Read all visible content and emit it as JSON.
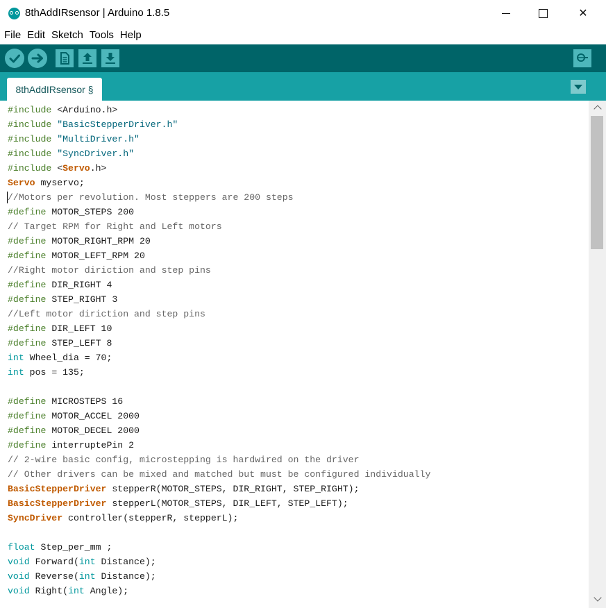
{
  "window": {
    "title": "8thAddIRsensor | Arduino 1.8.5",
    "controls": {
      "minimize": "minimize",
      "maximize": "maximize",
      "close": "✕"
    }
  },
  "menu": [
    "File",
    "Edit",
    "Sketch",
    "Tools",
    "Help"
  ],
  "toolbar": {
    "buttons": [
      {
        "name": "verify",
        "icon": "check-icon"
      },
      {
        "name": "upload",
        "icon": "arrow-right-icon"
      },
      {
        "name": "new",
        "icon": "document-icon"
      },
      {
        "name": "open",
        "icon": "arrow-up-icon"
      },
      {
        "name": "save",
        "icon": "arrow-down-icon"
      },
      {
        "name": "serial-monitor",
        "icon": "magnifier-icon"
      }
    ]
  },
  "tabs": [
    {
      "label": "8thAddIRsensor §",
      "active": true
    }
  ],
  "colors": {
    "toolbar": "#006468",
    "tabbar": "#17a1a5",
    "button": "#4db7bb",
    "keyword_class": "#c05a00",
    "keyword_type": "#00979c",
    "preprocessor": "#4a7f2a",
    "comment": "#666666",
    "string": "#00657a"
  },
  "editor": {
    "lines": [
      [
        [
          "preproc",
          "#include"
        ],
        [
          "plain",
          " <Arduino.h>"
        ]
      ],
      [
        [
          "preproc",
          "#include"
        ],
        [
          "plain",
          " "
        ],
        [
          "string",
          "\"BasicStepperDriver.h\""
        ]
      ],
      [
        [
          "preproc",
          "#include"
        ],
        [
          "plain",
          " "
        ],
        [
          "string",
          "\"MultiDriver.h\""
        ]
      ],
      [
        [
          "preproc",
          "#include"
        ],
        [
          "plain",
          " "
        ],
        [
          "string",
          "\"SyncDriver.h\""
        ]
      ],
      [
        [
          "preproc",
          "#include"
        ],
        [
          "plain",
          " <"
        ],
        [
          "class",
          "Servo"
        ],
        [
          "plain",
          ".h>"
        ]
      ],
      [
        [
          "class",
          "Servo"
        ],
        [
          "plain",
          " myservo;"
        ]
      ],
      [
        [
          "comment",
          "//Motors per revolution. Most steppers are 200 steps"
        ]
      ],
      [
        [
          "preproc",
          "#define"
        ],
        [
          "plain",
          " MOTOR_STEPS 200"
        ]
      ],
      [
        [
          "comment",
          "// Target RPM for Right and Left motors"
        ]
      ],
      [
        [
          "preproc",
          "#define"
        ],
        [
          "plain",
          " MOTOR_RIGHT_RPM 20"
        ]
      ],
      [
        [
          "preproc",
          "#define"
        ],
        [
          "plain",
          " MOTOR_LEFT_RPM 20"
        ]
      ],
      [
        [
          "comment",
          "//Right motor diriction and step pins"
        ]
      ],
      [
        [
          "preproc",
          "#define"
        ],
        [
          "plain",
          " DIR_RIGHT 4"
        ]
      ],
      [
        [
          "preproc",
          "#define"
        ],
        [
          "plain",
          " STEP_RIGHT 3"
        ]
      ],
      [
        [
          "comment",
          "//Left motor diriction and step pins"
        ]
      ],
      [
        [
          "preproc",
          "#define"
        ],
        [
          "plain",
          " DIR_LEFT 10"
        ]
      ],
      [
        [
          "preproc",
          "#define"
        ],
        [
          "plain",
          " STEP_LEFT 8"
        ]
      ],
      [
        [
          "type",
          "int"
        ],
        [
          "plain",
          " Wheel_dia = 70;"
        ]
      ],
      [
        [
          "type",
          "int"
        ],
        [
          "plain",
          " pos = 135;"
        ]
      ],
      [],
      [
        [
          "preproc",
          "#define"
        ],
        [
          "plain",
          " MICROSTEPS 16"
        ]
      ],
      [
        [
          "preproc",
          "#define"
        ],
        [
          "plain",
          " MOTOR_ACCEL 2000"
        ]
      ],
      [
        [
          "preproc",
          "#define"
        ],
        [
          "plain",
          " MOTOR_DECEL 2000"
        ]
      ],
      [
        [
          "preproc",
          "#define"
        ],
        [
          "plain",
          " interruptePin 2"
        ]
      ],
      [
        [
          "comment",
          "// 2-wire basic config, microstepping is hardwired on the driver"
        ]
      ],
      [
        [
          "comment",
          "// Other drivers can be mixed and matched but must be configured individually"
        ]
      ],
      [
        [
          "class",
          "BasicStepperDriver"
        ],
        [
          "plain",
          " stepperR(MOTOR_STEPS, DIR_RIGHT, STEP_RIGHT);"
        ]
      ],
      [
        [
          "class",
          "BasicStepperDriver"
        ],
        [
          "plain",
          " stepperL(MOTOR_STEPS, DIR_LEFT, STEP_LEFT);"
        ]
      ],
      [
        [
          "class",
          "SyncDriver"
        ],
        [
          "plain",
          " controller(stepperR, stepperL);"
        ]
      ],
      [],
      [
        [
          "type",
          "float"
        ],
        [
          "plain",
          " Step_per_mm ;"
        ]
      ],
      [
        [
          "type",
          "void"
        ],
        [
          "plain",
          " Forward("
        ],
        [
          "type",
          "int"
        ],
        [
          "plain",
          " Distance);"
        ]
      ],
      [
        [
          "type",
          "void"
        ],
        [
          "plain",
          " Reverse("
        ],
        [
          "type",
          "int"
        ],
        [
          "plain",
          " Distance);"
        ]
      ],
      [
        [
          "type",
          "void"
        ],
        [
          "plain",
          " Right("
        ],
        [
          "type",
          "int"
        ],
        [
          "plain",
          " Angle);"
        ]
      ]
    ]
  }
}
